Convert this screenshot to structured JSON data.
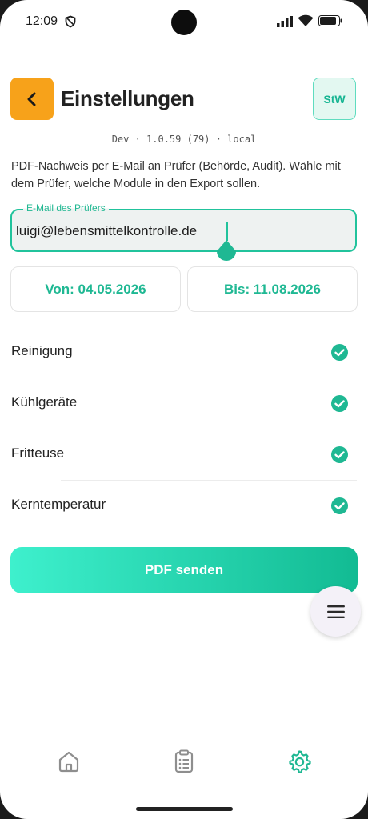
{
  "status_bar": {
    "time": "12:09"
  },
  "header": {
    "title": "Einstellungen",
    "avatar_initials": "StW"
  },
  "version": "Dev · 1.0.59 (79) · local",
  "description": "PDF-Nachweis per E-Mail an Prüfer (Behörde, Audit). Wähle mit dem Prüfer, welche Module in den Export sollen.",
  "email": {
    "label": "E-Mail des Prüfers",
    "value": "luigi@lebensmittelkontrolle.de"
  },
  "dates": {
    "from": "Von: 04.05.2026",
    "to": "Bis: 11.08.2026"
  },
  "modules": [
    {
      "label": "Reinigung",
      "checked": true
    },
    {
      "label": "Kühlgeräte",
      "checked": true
    },
    {
      "label": "Fritteuse",
      "checked": true
    },
    {
      "label": "Kerntemperatur",
      "checked": true
    }
  ],
  "send_label": "PDF senden",
  "colors": {
    "accent": "#1fb893",
    "back_button": "#f7a21a"
  },
  "nav": [
    "home-icon",
    "clipboard-list-icon",
    "gear-icon"
  ]
}
